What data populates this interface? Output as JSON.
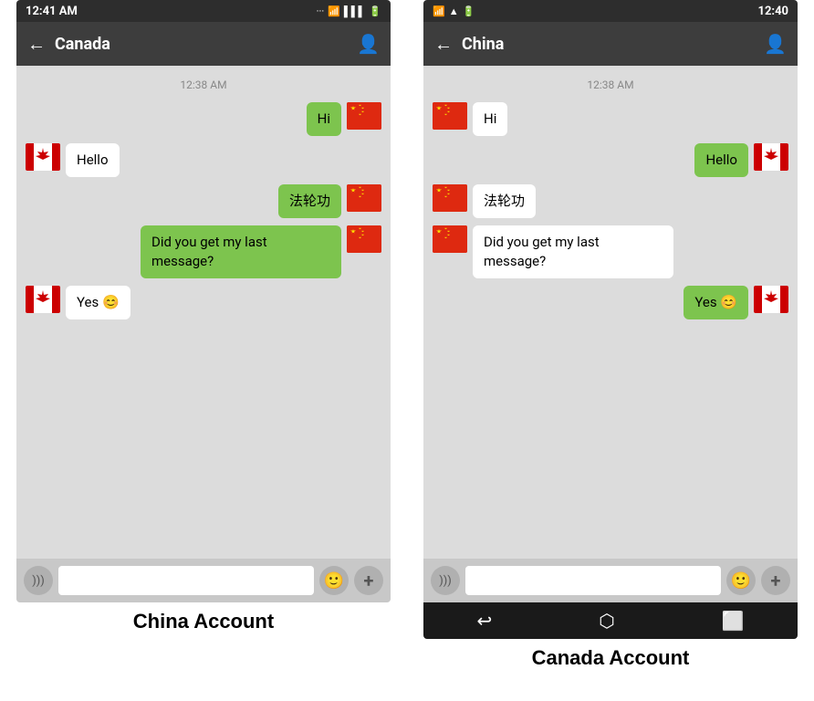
{
  "left_phone": {
    "label": "China Account",
    "status_bar": {
      "time": "12:41 AM",
      "signal": "●●●",
      "wifi": "WiFi",
      "battery": "Battery"
    },
    "nav": {
      "title": "Canada",
      "back": "←",
      "person": "👤"
    },
    "timestamp": "12:38 AM",
    "messages": [
      {
        "text": "Hi",
        "side": "right",
        "flag": "china"
      },
      {
        "text": "Hello",
        "side": "left",
        "flag": "canada"
      },
      {
        "text": "法轮功",
        "side": "right",
        "flag": "china"
      },
      {
        "text": "Did you get my last message?",
        "side": "right",
        "flag": "china"
      },
      {
        "text": "Yes 😊",
        "side": "left",
        "flag": "canada"
      }
    ],
    "input": {
      "placeholder": "",
      "voice": "))))",
      "emoji": "🙂",
      "plus": "+"
    }
  },
  "right_phone": {
    "label": "Canada Account",
    "status_bar": {
      "time": "12:40",
      "signal": "Signal",
      "wifi": "WiFi",
      "battery": "Battery"
    },
    "nav": {
      "title": "China",
      "back": "←",
      "person": "👤"
    },
    "timestamp": "12:38 AM",
    "messages": [
      {
        "text": "Hi",
        "side": "left",
        "flag": "china"
      },
      {
        "text": "Hello",
        "side": "right",
        "flag": "canada"
      },
      {
        "text": "法轮功",
        "side": "left",
        "flag": "china"
      },
      {
        "text": "Did you get my last message?",
        "side": "left",
        "flag": "china"
      },
      {
        "text": "Yes 😊",
        "side": "right",
        "flag": "canada"
      }
    ],
    "input": {
      "placeholder": "",
      "voice": "))))",
      "emoji": "🙂",
      "plus": "+"
    },
    "android_nav": [
      "↩",
      "⬡",
      "⬜"
    ]
  }
}
